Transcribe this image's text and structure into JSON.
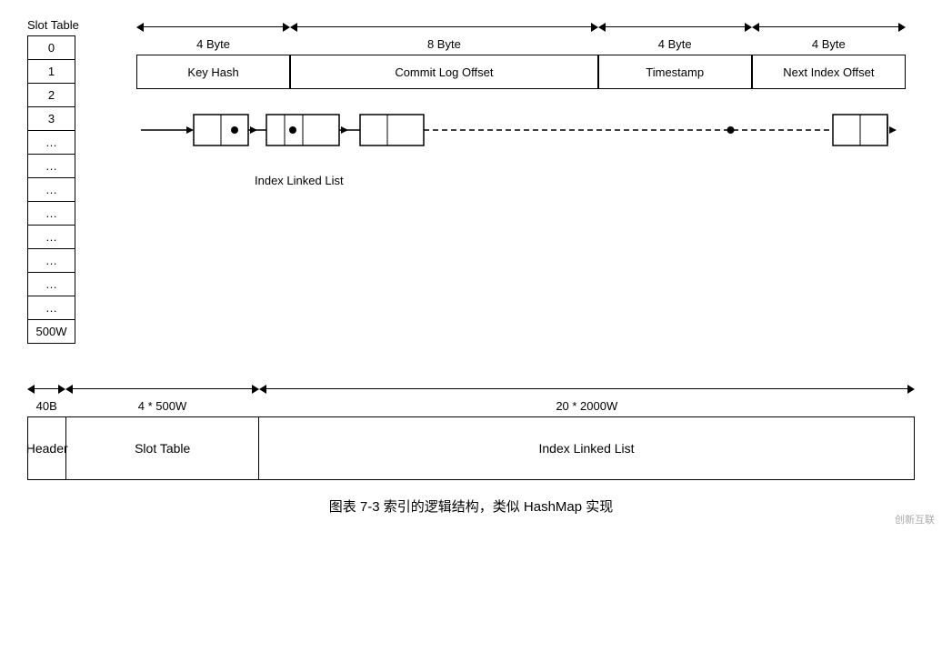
{
  "slotTable": {
    "label": "Slot Table",
    "rows": [
      "0",
      "1",
      "2",
      "3",
      "…",
      "…",
      "…",
      "…",
      "…",
      "…",
      "…",
      "…",
      "500W"
    ]
  },
  "byteLabels": [
    "4 Byte",
    "8 Byte",
    "4 Byte",
    "4 Byte"
  ],
  "fieldLabels": [
    "Key Hash",
    "Commit Log Offset",
    "Timestamp",
    "Next Index Offset"
  ],
  "linkedListLabel": "Index Linked List",
  "bottomArrows": [
    "40B",
    "4 * 500W",
    "20 * 2000W"
  ],
  "bottomCells": [
    "Header",
    "Slot Table",
    "Index Linked List"
  ],
  "caption": "图表 7-3 索引的逻辑结构，类似 HashMap 实现",
  "watermark": "创新互联"
}
